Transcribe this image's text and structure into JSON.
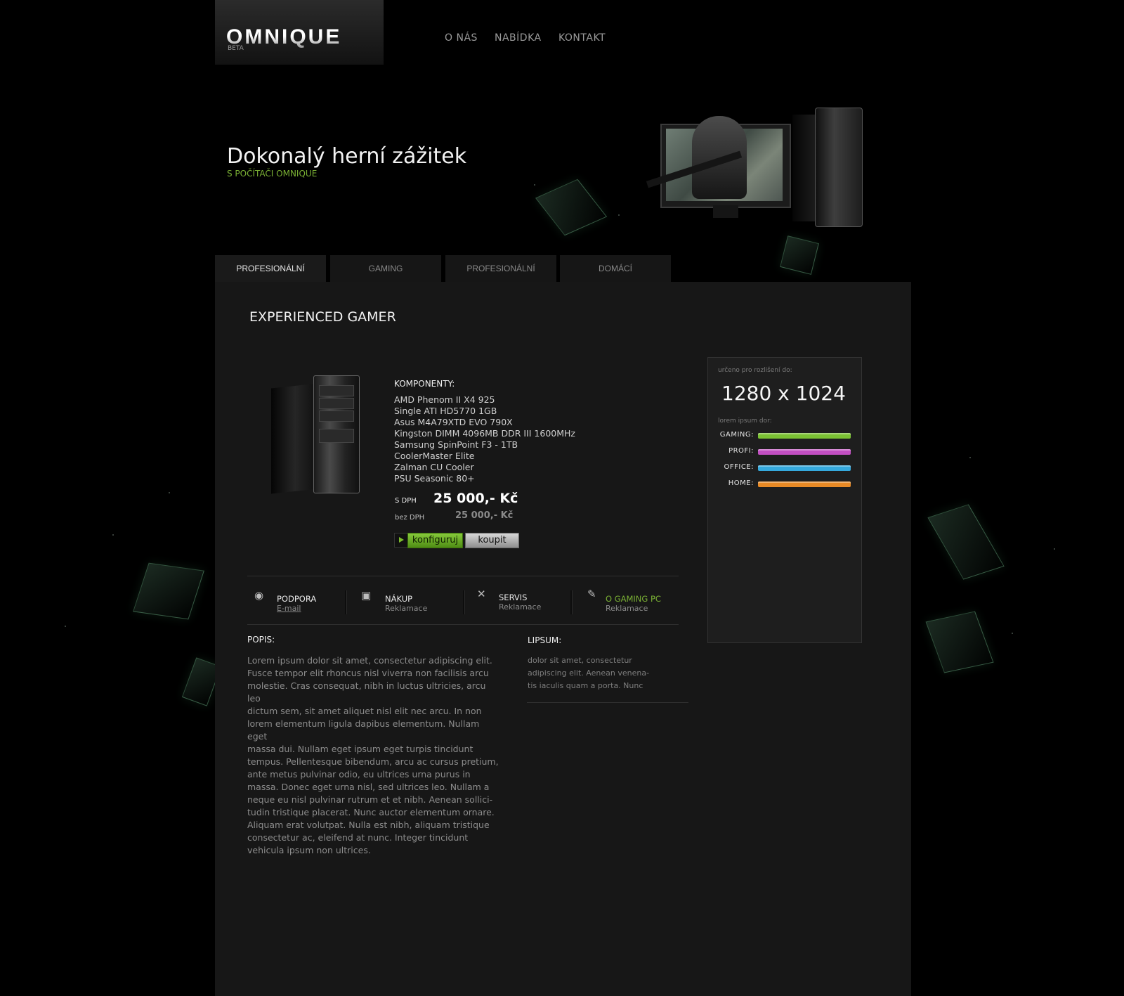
{
  "brand": {
    "name": "OMNIQUE",
    "tag": "BETA"
  },
  "nav": [
    "O NÁS",
    "NABÍDKA",
    "KONTAKT"
  ],
  "hero": {
    "title": "Dokonalý herní zážitek",
    "subtitle": "S POČÍTAČI OMNIQUE"
  },
  "tabs": [
    "PROFESIONÁLNÍ",
    "GAMING",
    "PROFESIONÁLNÍ",
    "DOMÁCÍ"
  ],
  "active_tab": 0,
  "product": {
    "title": "EXPERIENCED GAMER",
    "components_heading": "KOMPONENTY:",
    "components": [
      "AMD Phenom II X4 925",
      "Single ATI HD5770 1GB",
      "Asus M4A79XTD EVO 790X",
      "Kingston DIMM 4096MB DDR III 1600MHz",
      "Samsung SpinPoint F3 - 1TB",
      "CoolerMaster Elite",
      "Zalman CU Cooler",
      "PSU Seasonic 80+"
    ],
    "price_vat_label": "S DPH",
    "price_vat": "25 000,- Kč",
    "price_novat_label": "bez DPH",
    "price_novat": "25 000,- Kč",
    "configure_label": "konfiguruj",
    "buy_label": "koupit"
  },
  "features": [
    {
      "title": "PODPORA",
      "sub": "E-mail",
      "icon": "mouse-icon"
    },
    {
      "title": "NÁKUP",
      "sub": "Reklamace",
      "icon": "box-icon"
    },
    {
      "title": "SERVIS",
      "sub": "Reklamace",
      "icon": "wrench-icon"
    },
    {
      "title": "O GAMING PC",
      "sub": "Reklamace",
      "icon": "pen-icon"
    }
  ],
  "description": {
    "heading": "POPIS:",
    "lines": [
      "Lorem ipsum dolor sit amet, consectetur adipiscing elit.",
      "Fusce tempor elit rhoncus nisl viverra non facilisis arcu",
      "molestie. Cras consequat, nibh in luctus ultricies, arcu leo",
      "dictum sem, sit amet aliquet nisl elit nec arcu. In non",
      "lorem elementum ligula dapibus elementum. Nullam eget",
      "massa dui. Nullam eget ipsum eget turpis tincidunt",
      "tempus. Pellentesque bibendum, arcu ac cursus pretium,",
      "ante metus pulvinar odio, eu ultrices urna purus in",
      "massa. Donec eget urna nisl, sed ultrices leo. Nullam a",
      "neque eu nisl pulvinar rutrum et et nibh. Aenean sollici-",
      "tudin tristique placerat. Nunc auctor elementum ornare.",
      "Aliquam erat volutpat. Nulla est nibh, aliquam tristique",
      "consectetur ac, eleifend at nunc. Integer tincidunt",
      "vehicula ipsum non ultrices."
    ]
  },
  "lipsum": {
    "heading": "LIPSUM:",
    "lines": [
      "dolor sit amet, consectetur",
      "adipiscing elit. Aenean venena-",
      "tis iaculis quam a porta. Nunc"
    ]
  },
  "spec": {
    "res_label": "určeno pro rozlišení do:",
    "resolution": "1280 x 1024",
    "usage_label": "lorem ipsum dor:",
    "bars": [
      {
        "label": "GAMING:",
        "level": 1.0,
        "color": "#7bc233"
      },
      {
        "label": "PROFI:",
        "level": 1.0,
        "color": "#c24fc2"
      },
      {
        "label": "OFFICE:",
        "level": 1.0,
        "color": "#35a9dd"
      },
      {
        "label": "HOME:",
        "level": 1.0,
        "color": "#e88a26"
      }
    ]
  }
}
